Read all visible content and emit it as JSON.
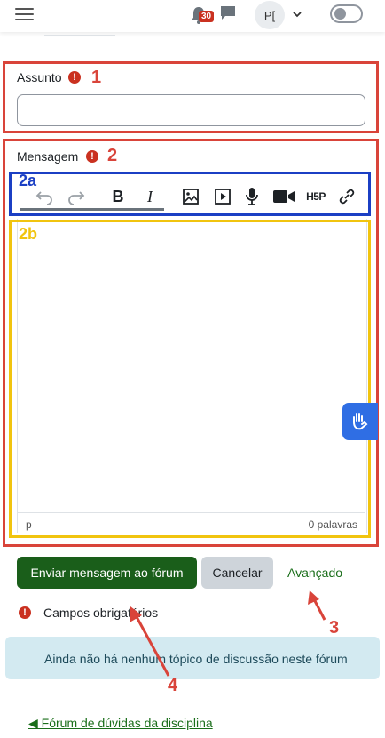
{
  "header": {
    "notification_count": "30",
    "user_initials": "P["
  },
  "form": {
    "subject": {
      "label": "Assunto",
      "value": ""
    },
    "message": {
      "label": "Mensagem",
      "word_count": "0 palavras",
      "path": "p"
    },
    "submit_label": "Enviar mensagem ao fórum",
    "cancel_label": "Cancelar",
    "advanced_label": "Avançado",
    "required_note": "Campos obrigatórios"
  },
  "editor_toolbar": {
    "icons": [
      "undo-icon",
      "redo-icon",
      "bold-icon",
      "italic-icon",
      "image-icon",
      "media-icon",
      "microphone-icon",
      "video-camera-icon",
      "h5p-icon",
      "link-icon"
    ],
    "bold_glyph": "B",
    "italic_glyph": "I",
    "h5p_text": "H5P"
  },
  "notice": "Ainda não há nenhum tópico de discussão neste fórum",
  "back_link": "◀ Fórum de dúvidas da disciplina",
  "annotations": {
    "n1": "1",
    "n2": "2",
    "n2a": "2a",
    "n2b": "2b",
    "n3": "3",
    "n4": "4"
  },
  "colors": {
    "annotation_red": "#d9443a",
    "annotation_blue": "#1b3fc4",
    "annotation_yellow": "#f1c40f",
    "primary_button": "#1a5e1a",
    "notice_bg": "#d3eaf1"
  }
}
